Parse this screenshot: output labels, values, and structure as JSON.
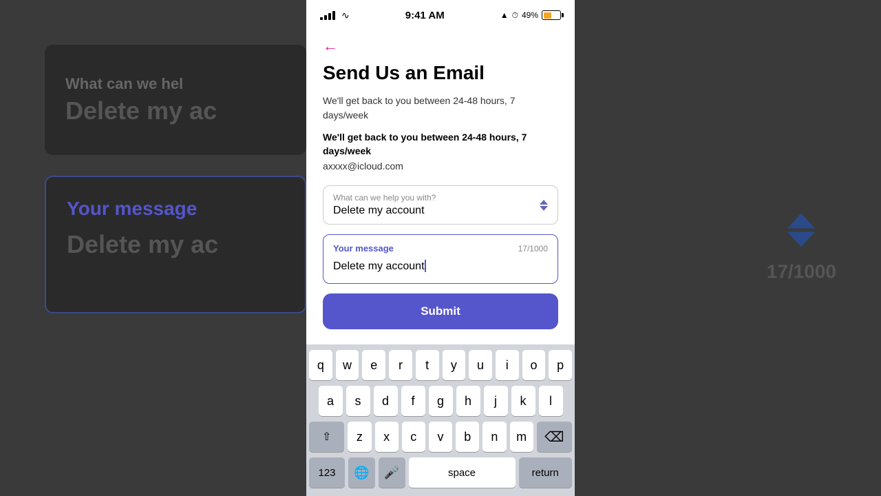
{
  "background": {
    "top_card": {
      "line1": "What can we hel",
      "line2": "Delete my ac"
    },
    "bottom_card": {
      "label": "Your message",
      "text": "Delete my ac"
    },
    "count": "17/1000"
  },
  "status_bar": {
    "time": "9:41 AM",
    "battery_pct": "49%"
  },
  "page": {
    "title": "Send Us an Email",
    "desc1": "We'll get back to you between 24-48 hours, 7 days/week",
    "desc2": "We'll get back to you between 24-48 hours, 7 days/week",
    "email": "axxxx@icloud.com",
    "dropdown": {
      "label": "What can we help you with?",
      "value": "Delete my account"
    },
    "message": {
      "label": "Your message",
      "count": "17/1000",
      "text": "Delete my account"
    },
    "submit_label": "Submit"
  },
  "keyboard": {
    "row1": [
      "q",
      "w",
      "e",
      "r",
      "t",
      "y",
      "u",
      "i",
      "o",
      "p"
    ],
    "row2": [
      "a",
      "s",
      "d",
      "f",
      "g",
      "h",
      "j",
      "k",
      "l"
    ],
    "row3": [
      "z",
      "x",
      "c",
      "v",
      "b",
      "n",
      "m"
    ],
    "space_label": "space",
    "return_label": "return",
    "num_label": "123",
    "delete_icon": "⌫",
    "shift_icon": "⇧",
    "globe_icon": "🌐",
    "mic_icon": "🎤"
  }
}
